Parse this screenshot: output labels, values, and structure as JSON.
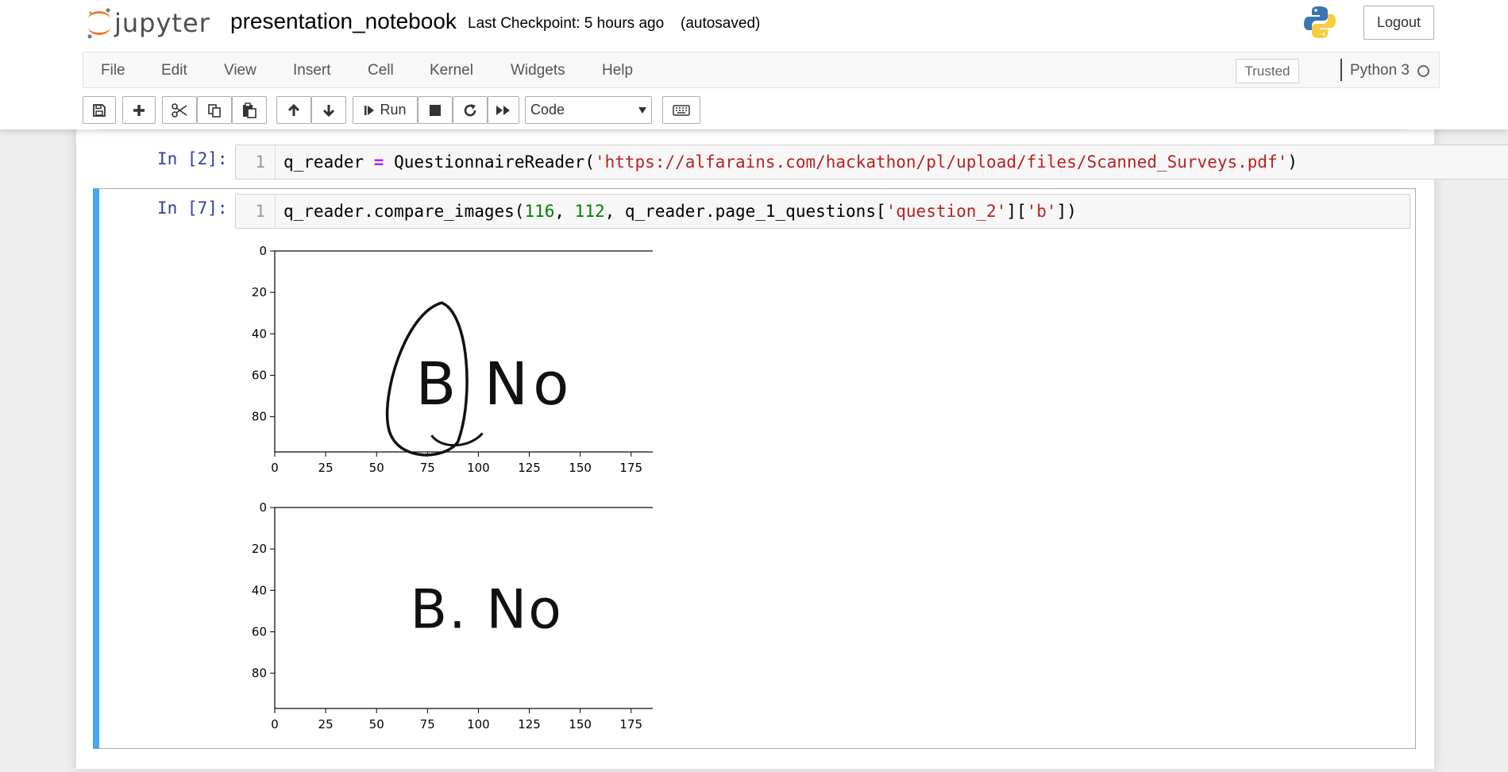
{
  "header": {
    "logo_text": "jupyter",
    "notebook_name": "presentation_notebook",
    "checkpoint": "Last Checkpoint: 5 hours ago",
    "autosave": "(autosaved)",
    "logout_label": "Logout"
  },
  "menubar": {
    "items": [
      "File",
      "Edit",
      "View",
      "Insert",
      "Cell",
      "Kernel",
      "Widgets",
      "Help"
    ],
    "trusted_label": "Trusted",
    "kernel_name": "Python 3"
  },
  "toolbar": {
    "run_label": "Run",
    "cell_type": "Code",
    "icons": [
      "save-icon",
      "plus-icon",
      "scissors-icon",
      "copy-icon",
      "paste-icon",
      "arrow-up-icon",
      "arrow-down-icon",
      "step-forward-icon",
      "stop-icon",
      "restart-icon",
      "fast-forward-icon",
      "keyboard-icon"
    ]
  },
  "cells": [
    {
      "prompt": "In [2]:",
      "line_number": "1",
      "code_tokens": [
        {
          "text": "q_reader ",
          "type": "plain"
        },
        {
          "text": "=",
          "type": "op"
        },
        {
          "text": " QuestionnaireReader(",
          "type": "plain"
        },
        {
          "text": "'https://alfarains.com/hackathon/pl/upload/files/Scanned_Surveys.pdf'",
          "type": "str"
        },
        {
          "text": ")",
          "type": "plain"
        }
      ]
    },
    {
      "prompt": "In [7]:",
      "line_number": "1",
      "code_tokens": [
        {
          "text": "q_reader.compare_images(",
          "type": "plain"
        },
        {
          "text": "116",
          "type": "num"
        },
        {
          "text": ", ",
          "type": "plain"
        },
        {
          "text": "112",
          "type": "num"
        },
        {
          "text": ", q_reader.page_1_questions[",
          "type": "plain"
        },
        {
          "text": "'question_2'",
          "type": "str"
        },
        {
          "text": "][",
          "type": "plain"
        },
        {
          "text": "'b'",
          "type": "str"
        },
        {
          "text": "])",
          "type": "plain"
        }
      ]
    }
  ],
  "chart_data": [
    {
      "type": "image",
      "image_text": "B No",
      "x_ticks": [
        "0",
        "25",
        "50",
        "75",
        "100",
        "125",
        "150",
        "175"
      ],
      "y_ticks": [
        "0",
        "20",
        "40",
        "60",
        "80"
      ],
      "xlim": [
        0,
        195
      ],
      "ylim": [
        97,
        0
      ],
      "circled": true
    },
    {
      "type": "image",
      "image_text": "B. No",
      "x_ticks": [
        "0",
        "25",
        "50",
        "75",
        "100",
        "125",
        "150",
        "175"
      ],
      "y_ticks": [
        "0",
        "20",
        "40",
        "60",
        "80"
      ],
      "xlim": [
        0,
        195
      ],
      "ylim": [
        97,
        0
      ],
      "circled": false
    }
  ],
  "colors": {
    "selected_cell_border": "#42a5f5",
    "prompt": "#303f9f",
    "string": "#ba2121",
    "number": "#008000",
    "operator": "#aa22ff"
  }
}
